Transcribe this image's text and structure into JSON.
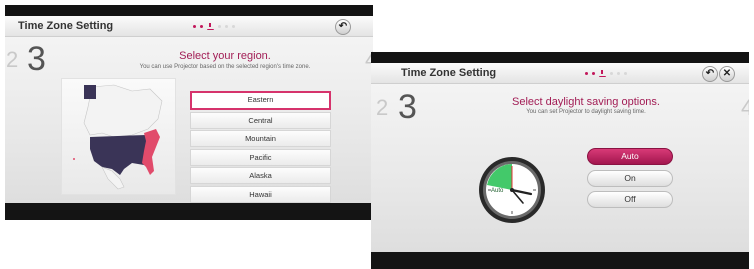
{
  "left_screen": {
    "title": "Time Zone Setting",
    "step_number": "3",
    "prev_step": "2",
    "next_step": "4",
    "heading": "Select your region.",
    "subtext": "You can use Projector based on the selected region's time zone.",
    "back_icon": "back-arrow-icon",
    "regions": [
      "Eastern",
      "Central",
      "Mountain",
      "Pacific",
      "Alaska",
      "Hawaii"
    ],
    "selected_region": "Eastern"
  },
  "right_screen": {
    "title": "Time Zone Setting",
    "step_number": "3",
    "prev_step": "2",
    "next_step": "4",
    "heading": "Select daylight saving options.",
    "subtext": "You can set Projector to daylight saving time.",
    "back_icon": "back-arrow-icon",
    "close_icon": "close-icon",
    "clock_label": "Auto",
    "options": [
      "Auto",
      "On",
      "Off"
    ],
    "selected_option": "Auto"
  },
  "colors": {
    "accent": "#c2185b",
    "map_highlight": "#d6336c",
    "map_usa": "#3a3457",
    "clock_green": "#43c96a"
  }
}
